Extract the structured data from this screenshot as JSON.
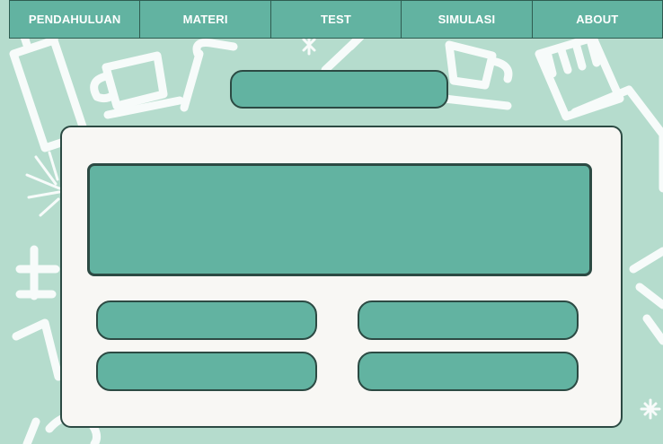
{
  "nav": {
    "items": [
      {
        "label": "PENDAHULUAN"
      },
      {
        "label": "MATERI"
      },
      {
        "label": "TEST"
      },
      {
        "label": "SIMULASI"
      },
      {
        "label": "ABOUT"
      }
    ]
  },
  "quiz": {
    "title": "",
    "question": "",
    "options": [
      "",
      "",
      "",
      ""
    ]
  },
  "colors": {
    "background": "#b5dccd",
    "accent": "#62b3a1",
    "border": "#2c4a43",
    "panel": "#f8f7f4"
  }
}
